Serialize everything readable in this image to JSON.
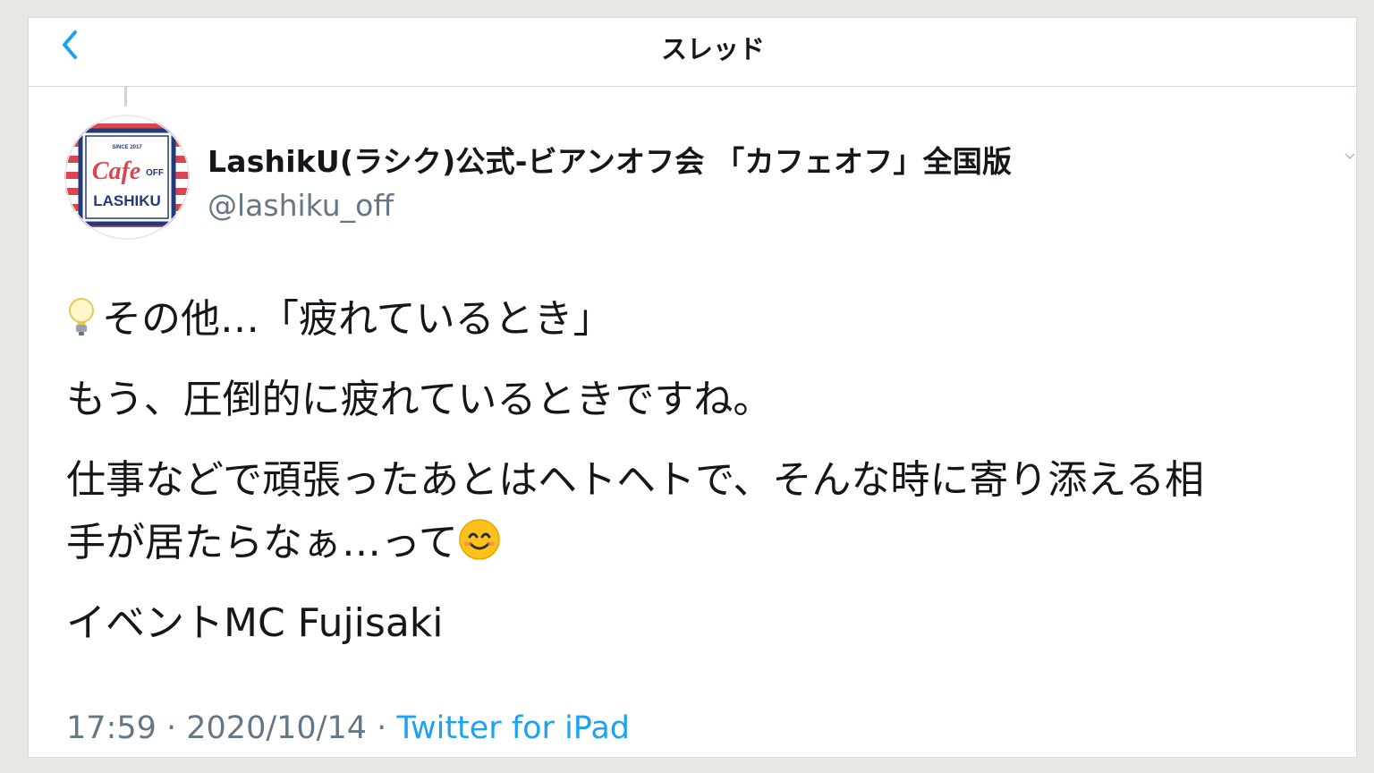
{
  "header": {
    "title": "スレッド",
    "back_icon": "chevron-left-icon"
  },
  "author": {
    "display_name": "LashikU(ラシク)公式-ビアンオフ会 「カフェオフ」全国版",
    "handle": "@lashiku_off",
    "avatar": {
      "since": "SINCE 2017",
      "script": "Cafe",
      "off": "OFF",
      "brand": "LASHIKU"
    }
  },
  "tweet": {
    "line1": "その他…「疲れているとき」",
    "line2": "もう、圧倒的に疲れているときですね。",
    "line3a": "仕事などで頑張ったあとはヘトヘトで、そんな時に寄り添える相",
    "line3b": "手が居たらなぁ…って",
    "line4": "イベントMC Fujisaki",
    "icons": [
      "light-bulb-icon",
      "smiling-face-icon"
    ]
  },
  "meta": {
    "time": "17:59",
    "sep1": " · ",
    "date": "2020/10/14",
    "sep2": " · ",
    "source": "Twitter for iPad"
  },
  "colors": {
    "accent": "#1da1f2",
    "muted": "#657786",
    "text": "#14171a",
    "avatar_navy": "#233a78",
    "avatar_red": "#d8474f"
  }
}
